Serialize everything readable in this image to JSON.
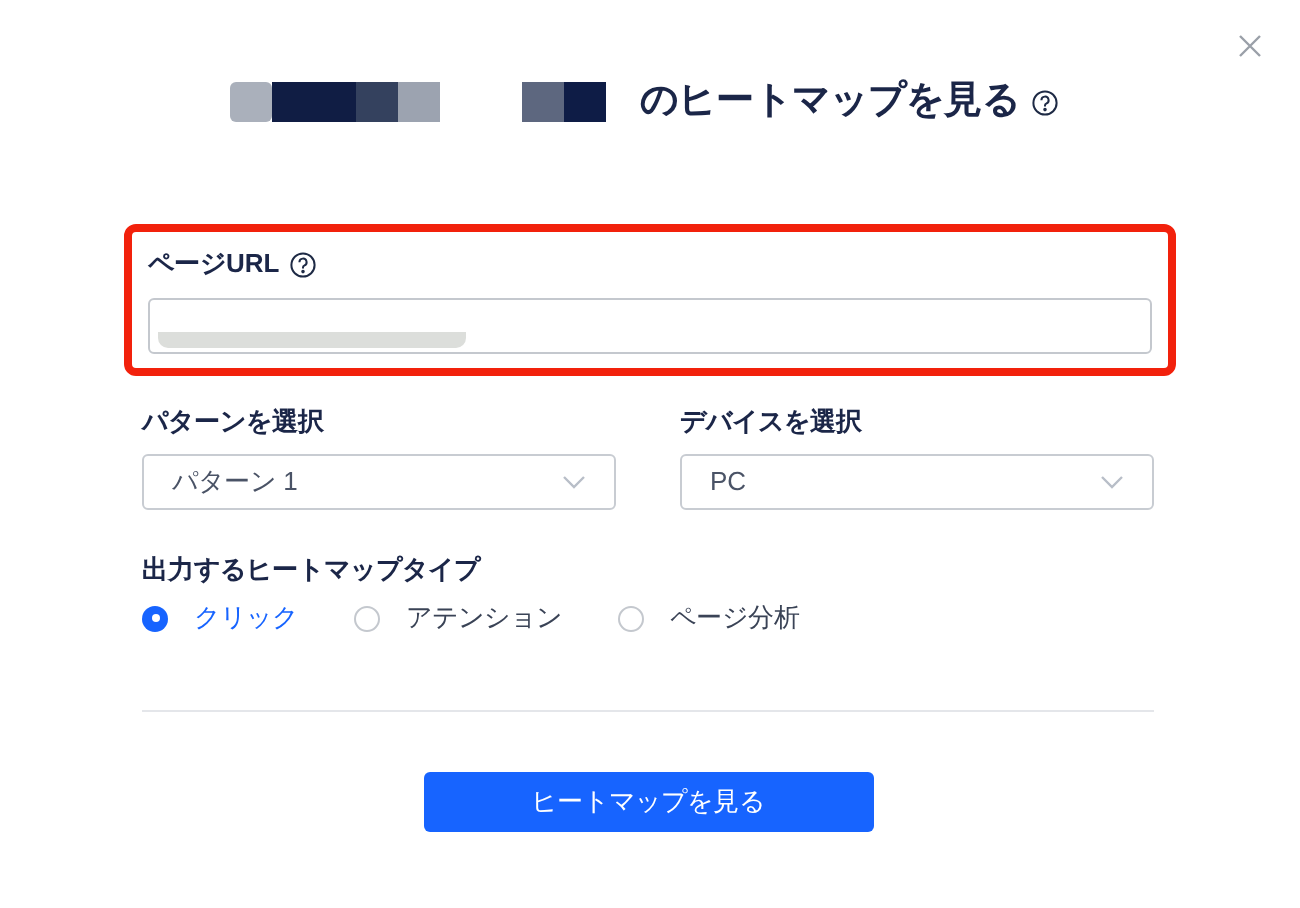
{
  "title": {
    "text": "のヒートマップを見る"
  },
  "page_url": {
    "label": "ページURL",
    "highlighted": true
  },
  "selects": [
    {
      "label": "パターンを選択",
      "value": "パターン 1"
    },
    {
      "label": "デバイスを選択",
      "value": "PC"
    }
  ],
  "heatmap_type": {
    "label": "出力するヒートマップタイプ",
    "options": [
      {
        "label": "クリック",
        "selected": true
      },
      {
        "label": "アテンション",
        "selected": false
      },
      {
        "label": "ページ分析",
        "selected": false
      }
    ]
  },
  "submit": {
    "label": "ヒートマップを見る"
  }
}
